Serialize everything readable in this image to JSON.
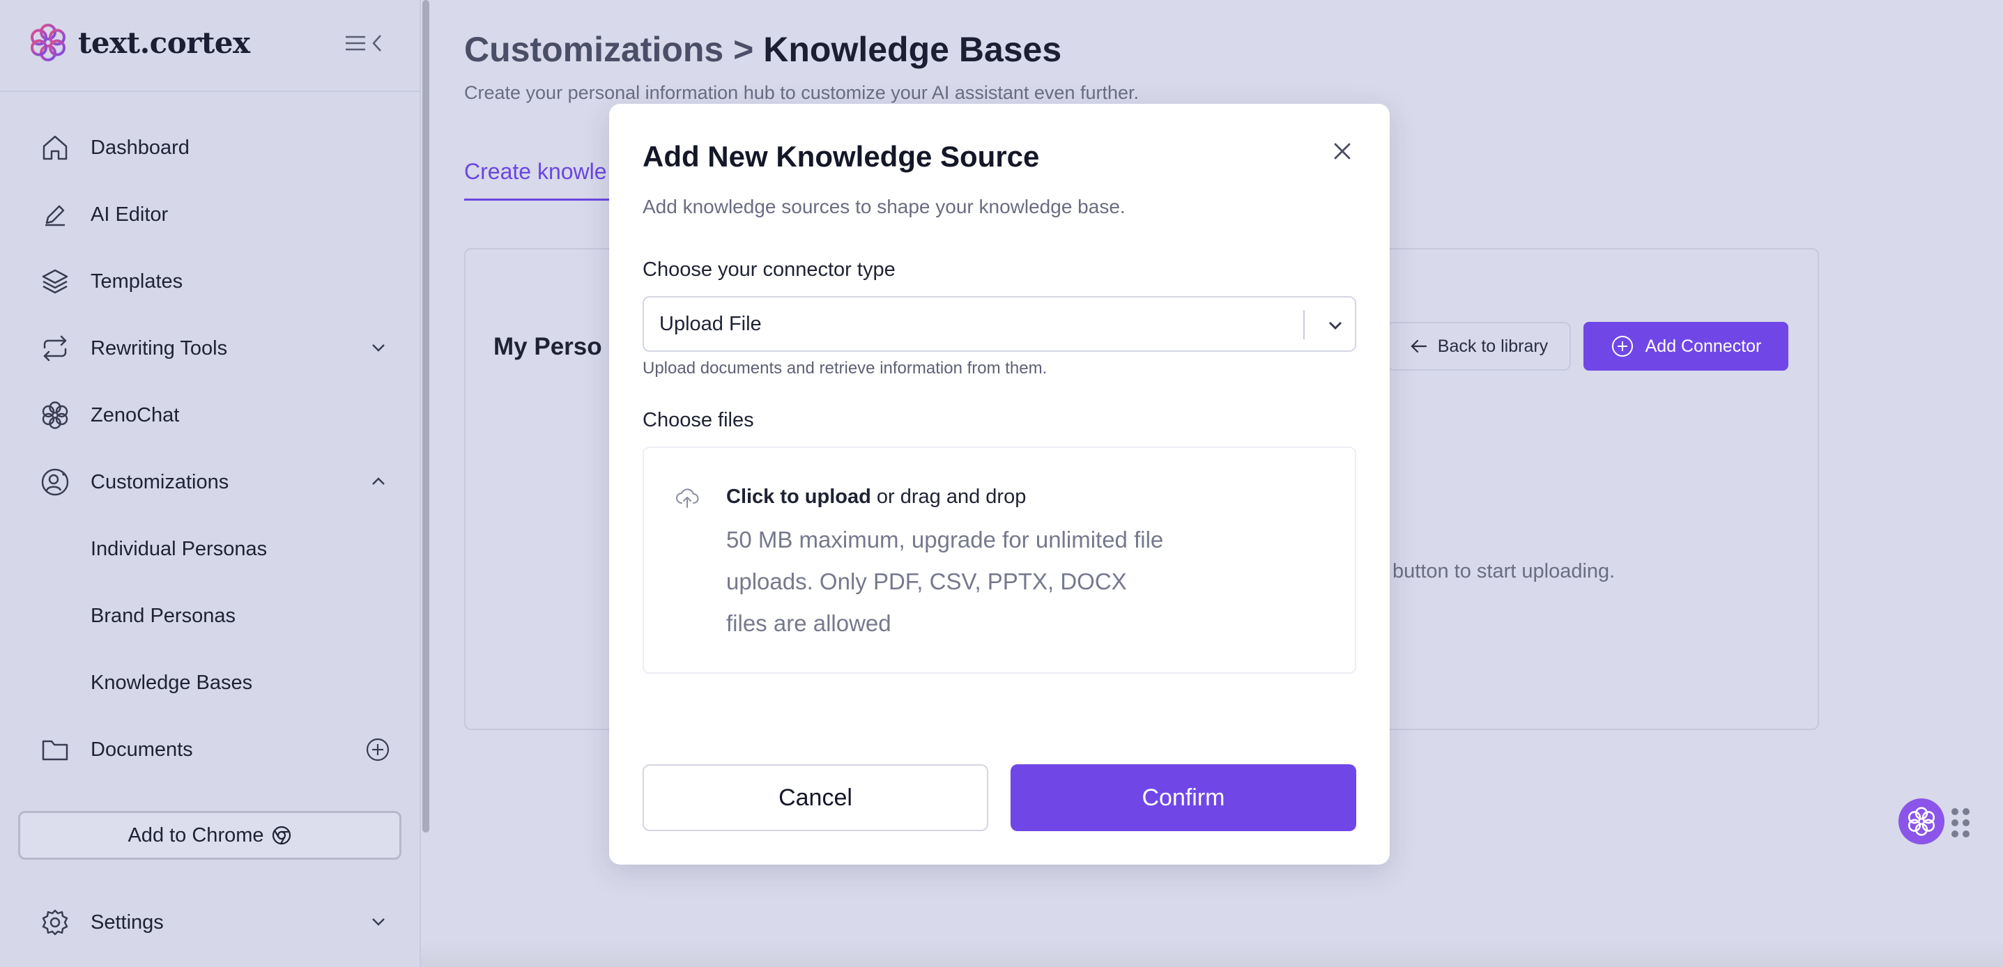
{
  "sidebar": {
    "logo": "text.cortex",
    "items": [
      {
        "label": "Dashboard",
        "icon": "home-icon"
      },
      {
        "label": "AI Editor",
        "icon": "pen-icon"
      },
      {
        "label": "Templates",
        "icon": "layers-icon"
      },
      {
        "label": "Rewriting Tools",
        "icon": "repeat-icon"
      },
      {
        "label": "ZenoChat",
        "icon": "flower-icon"
      },
      {
        "label": "Customizations",
        "icon": "user-circle-icon"
      }
    ],
    "sub_items": [
      "Individual Personas",
      "Brand Personas",
      "Knowledge Bases"
    ],
    "documents": "Documents",
    "add_to_chrome": "Add to Chrome",
    "settings": "Settings"
  },
  "main": {
    "breadcrumb_parent": "Customizations",
    "breadcrumb_sep": ">",
    "breadcrumb_current": "Knowledge Bases",
    "subtitle": "Create your personal information hub to customize your AI assistant even further.",
    "tab_active": "Create knowle",
    "card_title": "My Perso",
    "back_label": "Back to library",
    "add_connector_label": "Add Connector",
    "card_hint": "button to start uploading."
  },
  "modal": {
    "title": "Add New Knowledge Source",
    "subtitle": "Add knowledge sources to shape your knowledge base.",
    "connector_label": "Choose your connector type",
    "connector_value": "Upload File",
    "connector_help": "Upload documents and retrieve information from them.",
    "files_label": "Choose files",
    "upload_strong": "Click to upload",
    "upload_rest": " or drag and drop",
    "upload_desc": "50 MB maximum, upgrade for unlimited file uploads. Only PDF, CSV, PPTX, DOCX files are allowed",
    "cancel": "Cancel",
    "confirm": "Confirm"
  },
  "colors": {
    "accent": "#7047e6",
    "background": "#d8d9ea"
  }
}
